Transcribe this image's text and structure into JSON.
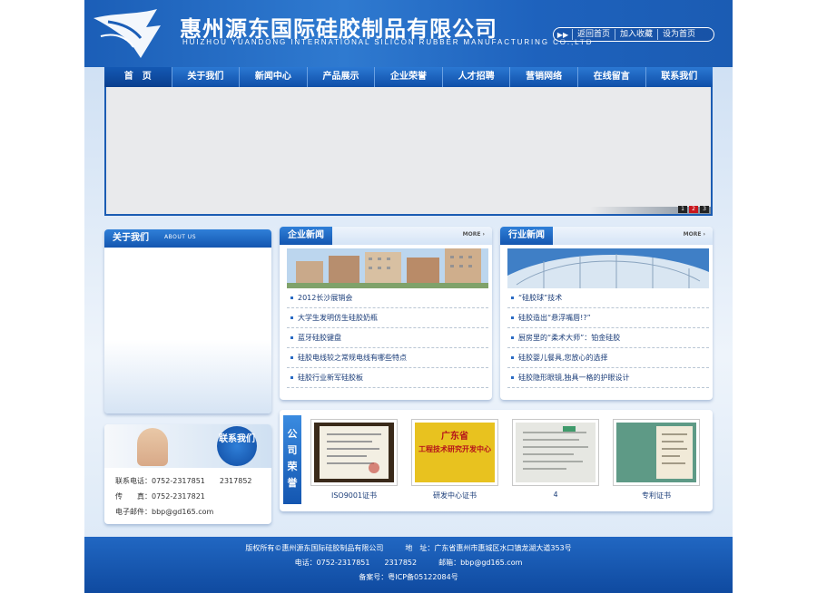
{
  "header": {
    "company_cn": "惠州源东国际硅胶制品有限公司",
    "company_en": "HUIZHOU YUANDONG INTERNATIONAL SILICON RUBBER MANUFACTURING CO.,LTD",
    "top_links": [
      "返回首页",
      "加入收藏",
      "设为首页"
    ]
  },
  "nav": {
    "items": [
      "首　页",
      "关于我们",
      "新闻中心",
      "产品展示",
      "企业荣誉",
      "人才招聘",
      "营销网络",
      "在线留言",
      "联系我们"
    ],
    "active_index": 0
  },
  "banner": {
    "pager": [
      "1",
      "2",
      "3"
    ],
    "active_page": 1
  },
  "about": {
    "title": "关于我们",
    "subtitle": "ABOUT US"
  },
  "contact": {
    "badge": "联系我们",
    "phone": "联系电话：0752-2317851　　2317852",
    "fax": "传　　真：0752-2317821",
    "email": "电子邮件：bbp@gd165.com"
  },
  "company_news": {
    "title": "企业新闻",
    "more": "MORE",
    "items": [
      "2012长沙展销会",
      "大学生发明仿生硅胶奶瓶",
      "蓝牙硅胶键盘",
      "硅胶电线较之常规电线有哪些特点",
      "硅胶行业新军硅胶板"
    ]
  },
  "industry_news": {
    "title": "行业新闻",
    "more": "MORE",
    "items": [
      "“硅胶球”技术",
      "硅胶造出“悬浮嘴唇!?”",
      "厨房里的“柔术大师”：铂金硅胶",
      "硅胶婴儿餐具,您放心的选择",
      "硅胶隐形眼镜,独具一格的护眼设计"
    ]
  },
  "honors": {
    "tag": "公司荣誉",
    "items": [
      {
        "caption": "ISO9001证书"
      },
      {
        "caption": "研发中心证书",
        "plaque_title": "广东省",
        "plaque_text": "工程技术研究开发中心"
      },
      {
        "caption": "4"
      },
      {
        "caption": "专利证书"
      }
    ]
  },
  "footer": {
    "line1": "版权所有©惠州源东国际硅胶制品有限公司　　　地　址：广东省惠州市惠城区水口镇龙湖大道353号",
    "line2": "电话：0752-2317851　　2317852　　　邮箱：bbp@gd165.com",
    "line3": "备案号：粤ICP备05122084号"
  },
  "colors": {
    "brand_blue": "#1b5cb3",
    "active_page": "#c8161d"
  }
}
